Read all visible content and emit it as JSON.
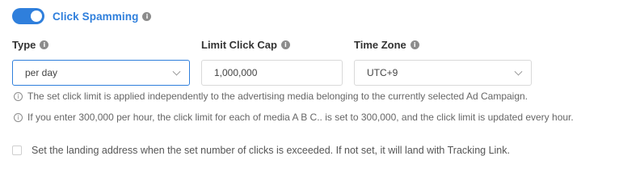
{
  "header": {
    "title": "Click Spamming",
    "toggle_on": true,
    "accent_color": "#2f7fdc",
    "info_icon": "info-icon"
  },
  "fields": {
    "type": {
      "label": "Type",
      "value": "per day"
    },
    "limit": {
      "label": "Limit Click Cap",
      "value": "1,000,000"
    },
    "timezone": {
      "label": "Time Zone",
      "value": "UTC+9"
    }
  },
  "notes": [
    "The set click limit is applied independently to the advertising media belonging to the currently selected Ad Campaign.",
    "If you enter 300,000 per hour, the click limit for each of media A B C.. is set to 300,000, and the click limit is updated every hour."
  ],
  "landing": {
    "checked": false,
    "label": "Set the landing address when the set number of clicks is exceeded. If not set, it will land with Tracking Link."
  }
}
